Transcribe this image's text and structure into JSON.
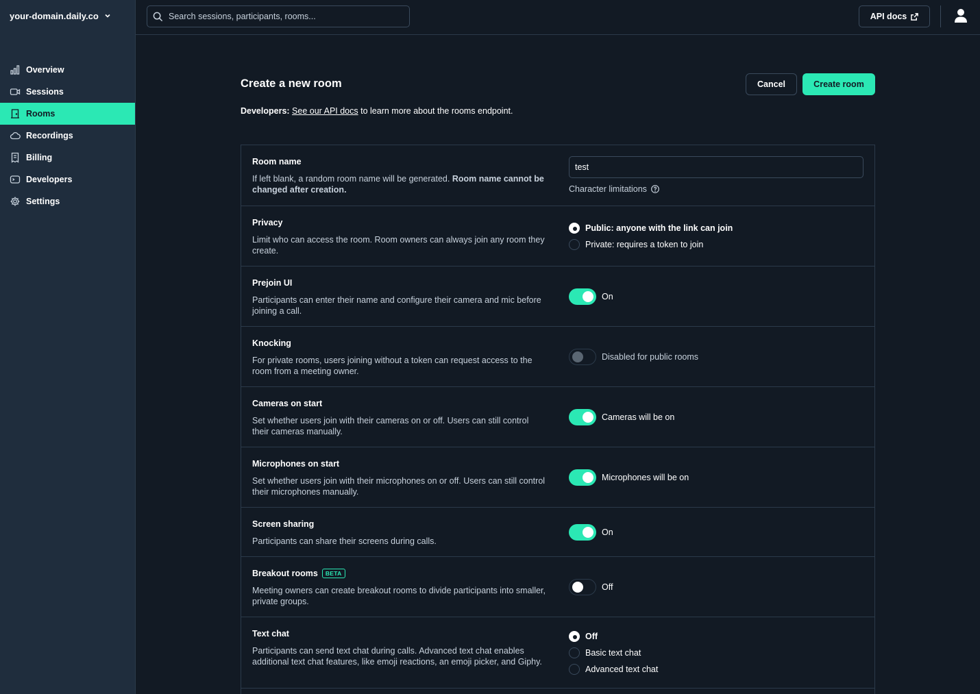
{
  "sidebar": {
    "domain": "your-domain.daily.co",
    "items": [
      {
        "label": "Overview",
        "icon": "bar-chart-icon"
      },
      {
        "label": "Sessions",
        "icon": "video-camera-icon"
      },
      {
        "label": "Rooms",
        "icon": "door-icon",
        "active": true
      },
      {
        "label": "Recordings",
        "icon": "cloud-icon"
      },
      {
        "label": "Billing",
        "icon": "receipt-icon"
      },
      {
        "label": "Developers",
        "icon": "terminal-icon"
      },
      {
        "label": "Settings",
        "icon": "gear-icon"
      }
    ]
  },
  "topbar": {
    "search_placeholder": "Search sessions, participants, rooms...",
    "api_docs": "API docs"
  },
  "main": {
    "title": "Create a new room",
    "cancel": "Cancel",
    "create": "Create room",
    "dev_prefix": "Developers:",
    "dev_link": "See our API docs",
    "dev_suffix": " to learn more about the rooms endpoint."
  },
  "settings": {
    "room_name": {
      "label": "Room name",
      "desc_plain": "If left blank, a random room name will be generated. ",
      "desc_bold": "Room name cannot be changed after creation.",
      "value": "test",
      "char_limits": "Character limitations"
    },
    "privacy": {
      "label": "Privacy",
      "desc": "Limit who can access the room. Room owners can always join any room they create.",
      "options": [
        "Public: anyone with the link can join",
        "Private: requires a token to join"
      ],
      "selected": 0
    },
    "prejoin": {
      "label": "Prejoin UI",
      "desc": "Participants can enter their name and configure their camera and mic before joining a call.",
      "state": "On"
    },
    "knocking": {
      "label": "Knocking",
      "desc": "For private rooms, users joining without a token can request access to the room from a meeting owner.",
      "state": "Disabled for public rooms"
    },
    "cameras": {
      "label": "Cameras on start",
      "desc": "Set whether users join with their cameras on or off. Users can still control their cameras manually.",
      "state": "Cameras will be on"
    },
    "mics": {
      "label": "Microphones on start",
      "desc": "Set whether users join with their microphones on or off. Users can still control their microphones manually.",
      "state": "Microphones will be on"
    },
    "screenshare": {
      "label": "Screen sharing",
      "desc": "Participants can share their screens during calls.",
      "state": "On"
    },
    "breakout": {
      "label": "Breakout rooms",
      "badge": "BETA",
      "desc": "Meeting owners can create breakout rooms to divide participants into smaller, private groups.",
      "state": "Off"
    },
    "textchat": {
      "label": "Text chat",
      "desc": "Participants can send text chat during calls. Advanced text chat enables additional text chat features, like emoji reactions, an emoji picker, and Giphy.",
      "options": [
        "Off",
        "Basic text chat",
        "Advanced text chat"
      ],
      "selected": 0
    }
  },
  "colors": {
    "accent": "#2be8b4",
    "background": "#121a24",
    "sidebar": "#1f2d3d"
  }
}
